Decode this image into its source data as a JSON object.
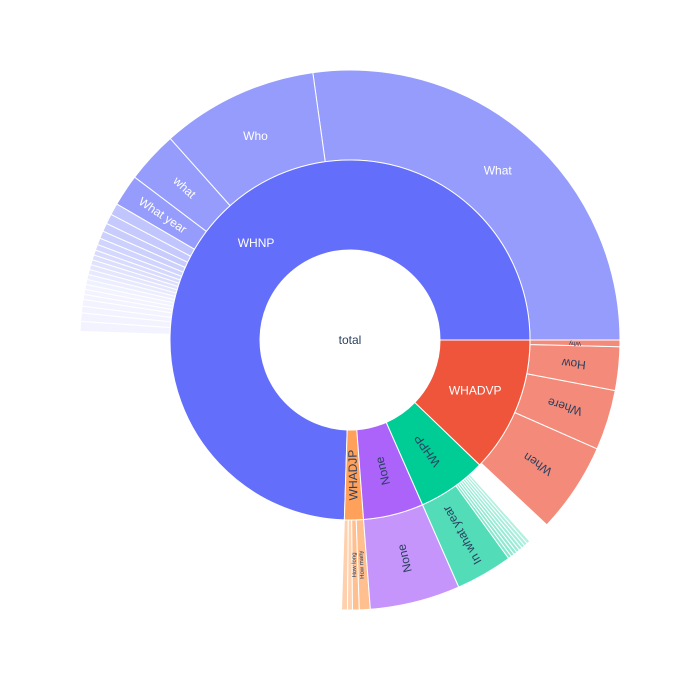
{
  "chart_data": {
    "type": "sunburst",
    "center_label": "total",
    "colors": {
      "WHNP": "#636efa",
      "WHADJP": "#ffa15a",
      "None": "#ab63fa",
      "WHPP": "#00cc96",
      "WHADVP": "#ef553b"
    },
    "segments": [
      {
        "label": "WHNP",
        "color": "#636efa",
        "start": 0,
        "end": 74.5,
        "children": [
          {
            "label": "What",
            "start": 0,
            "end": 27.2
          },
          {
            "label": "Who",
            "start": 27.2,
            "end": 36.6
          },
          {
            "label": "what",
            "start": 36.6,
            "end": 39.7
          },
          {
            "label": "What year",
            "start": 39.7,
            "end": 41.6
          },
          {
            "label": "",
            "start": 41.6,
            "end": 42.3
          },
          {
            "label": "",
            "start": 42.3,
            "end": 42.9
          },
          {
            "label": "",
            "start": 42.9,
            "end": 43.4
          },
          {
            "label": "",
            "start": 43.4,
            "end": 43.85
          },
          {
            "label": "",
            "start": 43.85,
            "end": 44.25
          },
          {
            "label": "",
            "start": 44.25,
            "end": 44.6
          },
          {
            "label": "",
            "start": 44.6,
            "end": 44.9
          },
          {
            "label": "",
            "start": 44.9,
            "end": 45.2
          },
          {
            "label": "",
            "start": 45.2,
            "end": 45.5
          },
          {
            "label": "",
            "start": 45.5,
            "end": 45.8
          },
          {
            "label": "",
            "start": 45.8,
            "end": 46.1
          },
          {
            "label": "",
            "start": 46.1,
            "end": 46.4
          },
          {
            "label": "",
            "start": 46.4,
            "end": 46.7
          },
          {
            "label": "",
            "start": 46.7,
            "end": 47.0
          },
          {
            "label": "",
            "start": 47.0,
            "end": 47.3
          },
          {
            "label": "",
            "start": 47.3,
            "end": 47.6
          },
          {
            "label": "",
            "start": 47.6,
            "end": 48.0
          },
          {
            "label": "",
            "start": 48.0,
            "end": 48.4
          },
          {
            "label": "",
            "start": 48.4,
            "end": 48.9
          },
          {
            "label": "",
            "start": 48.9,
            "end": 49.5
          }
        ]
      },
      {
        "label": "WHADJP",
        "color": "#ffa15a",
        "start": 74.5,
        "end": 76.2,
        "children": [
          {
            "label": "",
            "start": 74.5,
            "end": 74.85
          },
          {
            "label": "",
            "start": 74.85,
            "end": 75.15
          },
          {
            "label": "How long",
            "start": 75.15,
            "end": 75.55
          },
          {
            "label": "How many",
            "start": 75.55,
            "end": 76.2
          }
        ]
      },
      {
        "label": "None",
        "color": "#ab63fa",
        "start": 76.2,
        "end": 81.6,
        "children": [
          {
            "label": "None",
            "start": 76.2,
            "end": 81.6
          }
        ]
      },
      {
        "label": "WHPP",
        "color": "#00cc96",
        "start": 81.6,
        "end": 87.8,
        "children": [
          {
            "label": "In what year",
            "start": 81.6,
            "end": 85.0
          },
          {
            "label": "",
            "start": 85.0,
            "end": 85.2
          },
          {
            "label": "",
            "start": 85.2,
            "end": 85.4
          },
          {
            "label": "",
            "start": 85.4,
            "end": 85.6
          },
          {
            "label": "",
            "start": 85.6,
            "end": 85.8
          },
          {
            "label": "",
            "start": 85.8,
            "end": 86.0
          },
          {
            "label": "",
            "start": 86.0,
            "end": 86.2
          },
          {
            "label": "",
            "start": 86.2,
            "end": 86.4
          },
          {
            "label": "",
            "start": 86.4,
            "end": 86.6
          }
        ]
      },
      {
        "label": "WHADVP",
        "color": "#ef553b",
        "start": 87.8,
        "end": 100,
        "children": [
          {
            "label": "When",
            "start": 88.0,
            "end": 93.4
          },
          {
            "label": "Where",
            "start": 93.4,
            "end": 97.0
          },
          {
            "label": "How",
            "start": 97.0,
            "end": 99.6
          },
          {
            "label": "Why",
            "start": 99.6,
            "end": 100.0
          }
        ]
      }
    ]
  }
}
